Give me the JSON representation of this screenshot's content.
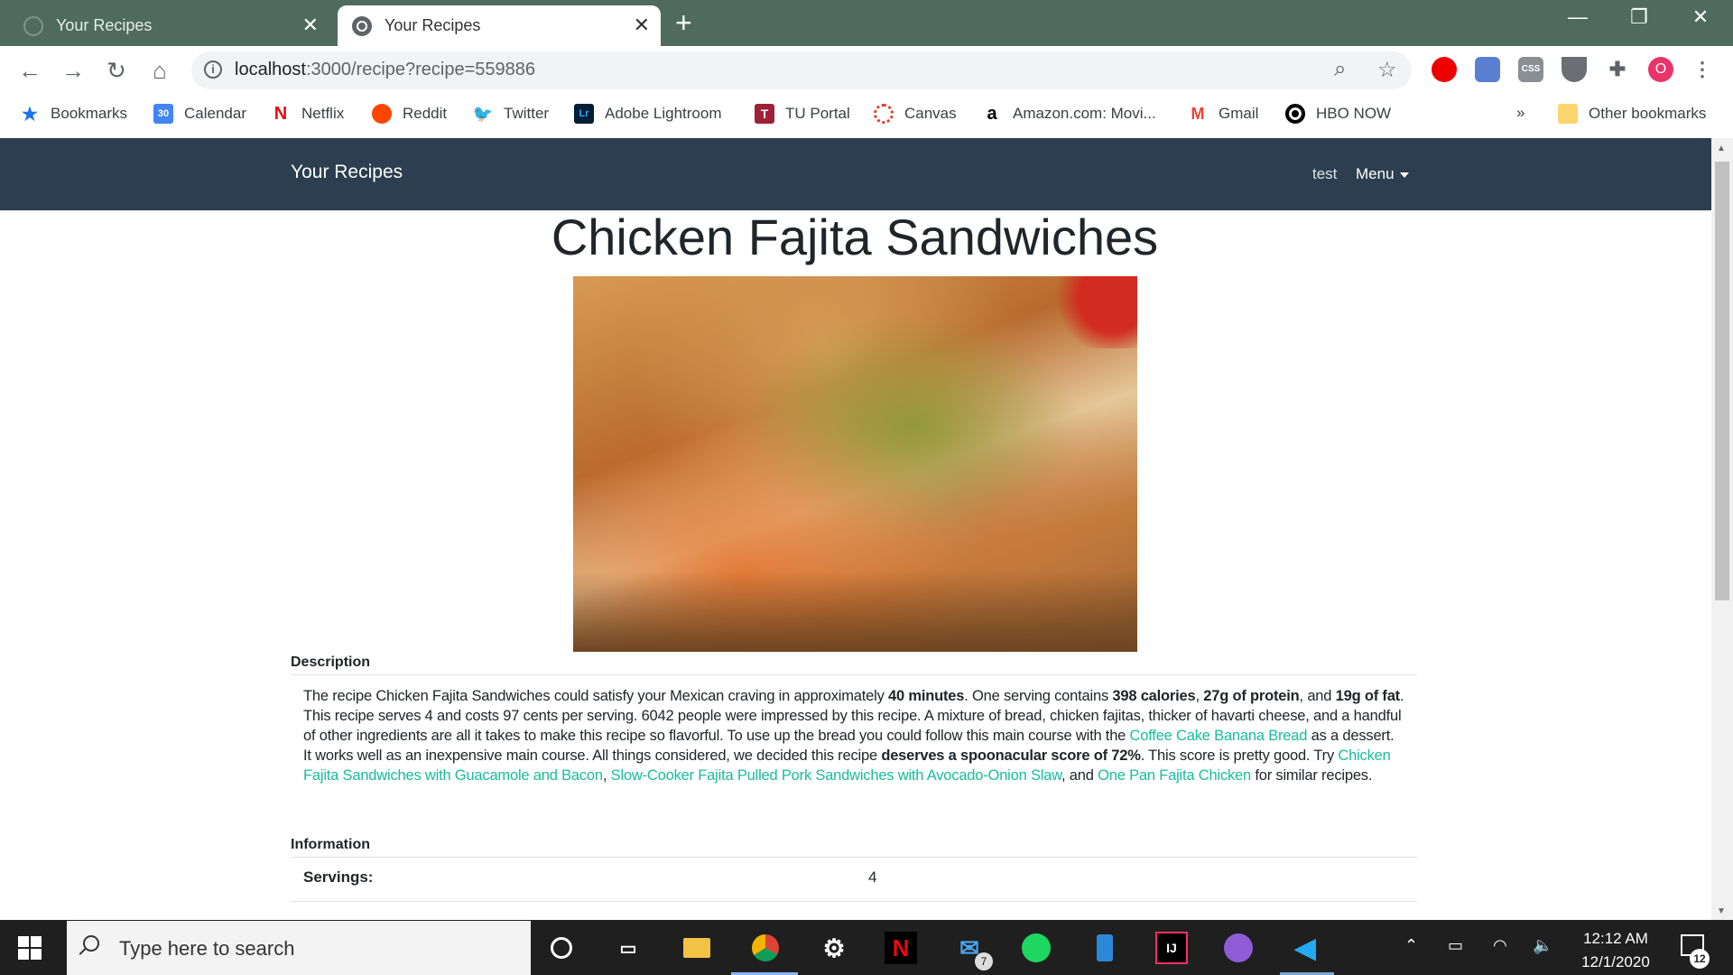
{
  "browser": {
    "tabs": [
      {
        "title": "Your Recipes",
        "active": false
      },
      {
        "title": "Your Recipes",
        "active": true
      }
    ],
    "url_host": "localhost",
    "url_rest": ":3000/recipe?recipe=559886",
    "profile_initial": "O",
    "bookmarks": [
      {
        "label": "Bookmarks",
        "icon": "star-icon"
      },
      {
        "label": "Calendar",
        "icon": "calendar-icon",
        "glyph": "30"
      },
      {
        "label": "Netflix",
        "icon": "netflix-icon",
        "glyph": "N"
      },
      {
        "label": "Reddit",
        "icon": "reddit-icon"
      },
      {
        "label": "Twitter",
        "icon": "twitter-icon"
      },
      {
        "label": "Adobe Lightroom",
        "icon": "lightroom-icon",
        "glyph": "Lr"
      },
      {
        "label": "TU Portal",
        "icon": "tu-icon",
        "glyph": "T"
      },
      {
        "label": "Canvas",
        "icon": "canvas-icon"
      },
      {
        "label": "Amazon.com: Movi...",
        "icon": "amazon-icon",
        "glyph": "a"
      },
      {
        "label": "Gmail",
        "icon": "gmail-icon",
        "glyph": "M"
      },
      {
        "label": "HBO NOW",
        "icon": "hbo-icon"
      }
    ],
    "overflow_label": "»",
    "other_bookmarks": "Other bookmarks"
  },
  "navbar": {
    "brand": "Your Recipes",
    "user": "test",
    "menu": "Menu"
  },
  "recipe": {
    "title": "Chicken Fajita Sandwiches",
    "image_alt": "Chicken fajita sandwich photo",
    "description_heading": "Description",
    "description": {
      "p1": "The recipe Chicken Fajita Sandwiches could satisfy your Mexican craving in approximately ",
      "b1": "40 minutes",
      "p2": ". One serving contains ",
      "b2": "398 calories",
      "p3": ", ",
      "b3": "27g of protein",
      "p4": ", and ",
      "b4": "19g of fat",
      "p5": ". This recipe serves 4 and costs 97 cents per serving. 6042 people were impressed by this recipe. A mixture of bread, chicken fajitas, thicker of havarti cheese, and a handful of other ingredients are all it takes to make this recipe so flavorful. To use up the bread you could follow this main course with the ",
      "l1": "Coffee Cake Banana Bread",
      "p6": " as a dessert. It works well as an inexpensive main course. All things considered, we decided this recipe ",
      "b5": "deserves a spoonacular score of 72%",
      "p7": ". This score is pretty good. Try ",
      "l2": "Chicken Fajita Sandwiches with Guacamole and Bacon",
      "p8": ", ",
      "l3": "Slow-Cooker Fajita Pulled Pork Sandwiches with Avocado-Onion Slaw",
      "p9": ", and ",
      "l4": "One Pan Fajita Chicken",
      "p10": " for similar recipes."
    },
    "information_heading": "Information",
    "info_rows": [
      {
        "label": "Servings:",
        "value": "4"
      }
    ]
  },
  "taskbar": {
    "search_placeholder": "Type here to search",
    "time": "12:12 AM",
    "date": "12/1/2020",
    "mail_badge": "7",
    "notification_count": "12"
  },
  "colors": {
    "tabbar": "#4f6b5f",
    "navbar": "#2c3e50",
    "link": "#18bc9c",
    "taskbar": "#1f1f1f"
  }
}
